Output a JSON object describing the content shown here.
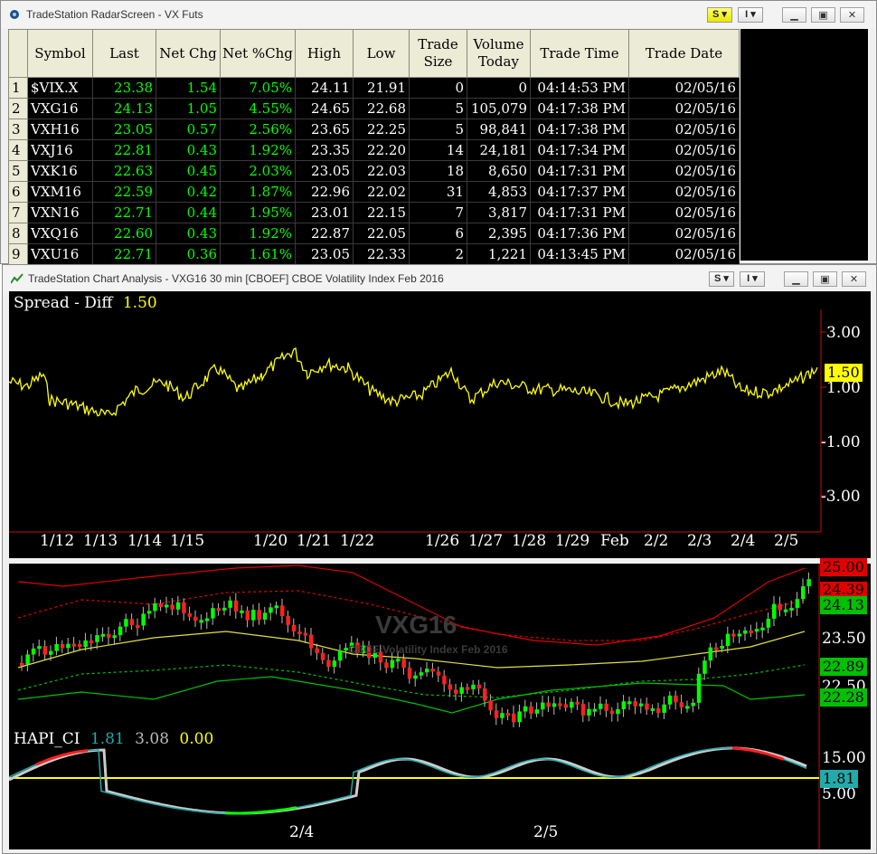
{
  "radar": {
    "title": "TradeStation RadarScreen - VX Futs",
    "btn_s": "S",
    "btn_i": "I",
    "columns": [
      "Symbol",
      "Last",
      "Net Chg",
      "Net %Chg",
      "High",
      "Low",
      "Trade Size",
      "Volume Today",
      "Trade Time",
      "Trade Date"
    ],
    "rows": [
      {
        "n": "1",
        "symbol": "$VIX.X",
        "last": "23.38",
        "net_chg": "1.54",
        "net_pct": "7.05%",
        "high": "24.11",
        "low": "21.91",
        "size": "0",
        "volume": "0",
        "time": "04:14:53 PM",
        "date": "02/05/16"
      },
      {
        "n": "2",
        "symbol": "VXG16",
        "last": "24.13",
        "net_chg": "1.05",
        "net_pct": "4.55%",
        "high": "24.65",
        "low": "22.68",
        "size": "5",
        "volume": "105,079",
        "time": "04:17:38 PM",
        "date": "02/05/16"
      },
      {
        "n": "3",
        "symbol": "VXH16",
        "last": "23.05",
        "net_chg": "0.57",
        "net_pct": "2.56%",
        "high": "23.65",
        "low": "22.25",
        "size": "5",
        "volume": "98,841",
        "time": "04:17:38 PM",
        "date": "02/05/16"
      },
      {
        "n": "4",
        "symbol": "VXJ16",
        "last": "22.81",
        "net_chg": "0.43",
        "net_pct": "1.92%",
        "high": "23.35",
        "low": "22.20",
        "size": "14",
        "volume": "24,181",
        "time": "04:17:34 PM",
        "date": "02/05/16"
      },
      {
        "n": "5",
        "symbol": "VXK16",
        "last": "22.63",
        "net_chg": "0.45",
        "net_pct": "2.03%",
        "high": "23.05",
        "low": "22.03",
        "size": "18",
        "volume": "8,650",
        "time": "04:17:31 PM",
        "date": "02/05/16"
      },
      {
        "n": "6",
        "symbol": "VXM16",
        "last": "22.59",
        "net_chg": "0.42",
        "net_pct": "1.87%",
        "high": "22.96",
        "low": "22.02",
        "size": "31",
        "volume": "4,853",
        "time": "04:17:37 PM",
        "date": "02/05/16"
      },
      {
        "n": "7",
        "symbol": "VXN16",
        "last": "22.71",
        "net_chg": "0.44",
        "net_pct": "1.95%",
        "high": "23.01",
        "low": "22.15",
        "size": "7",
        "volume": "3,817",
        "time": "04:17:31 PM",
        "date": "02/05/16"
      },
      {
        "n": "8",
        "symbol": "VXQ16",
        "last": "22.60",
        "net_chg": "0.43",
        "net_pct": "1.92%",
        "high": "22.87",
        "low": "22.05",
        "size": "6",
        "volume": "2,395",
        "time": "04:17:36 PM",
        "date": "02/05/16"
      },
      {
        "n": "9",
        "symbol": "VXU16",
        "last": "22.71",
        "net_chg": "0.36",
        "net_pct": "1.61%",
        "high": "23.05",
        "low": "22.33",
        "size": "2",
        "volume": "1,221",
        "time": "04:13:45 PM",
        "date": "02/05/16"
      }
    ]
  },
  "chart": {
    "title": "TradeStation Chart Analysis - VXG16 30 min [CBOEF] CBOE Volatility Index Feb 2016",
    "btn_s": "S",
    "btn_i": "I",
    "spread": {
      "label": "Spread - Diff",
      "value": "1.50",
      "yticks": [
        "3.00",
        "1.00",
        "-1.00",
        "-3.00"
      ],
      "last_tag": "1.50",
      "dates": [
        "1/12",
        "1/13",
        "1/14",
        "1/15",
        "1/20",
        "1/21",
        "1/22",
        "1/26",
        "1/27",
        "1/28",
        "1/29",
        "Feb",
        "2/2",
        "2/3",
        "2/4",
        "2/5"
      ]
    },
    "price": {
      "watermark": "VXG16",
      "watermark_sub": "CBOE Volatility Index Feb 2016",
      "ticks": [
        "25.00",
        "24.39",
        "24.13",
        "23.50",
        "22.89",
        "22.50",
        "22.28"
      ],
      "tag_colors": {
        "red": "#e00000",
        "green": "#00c000",
        "last": "#00c000"
      }
    },
    "hapi": {
      "label": "HAPI_CI",
      "v1": "1.81",
      "v2": "3.08",
      "v3": "0.00",
      "ticks": [
        "15.00",
        "1.81",
        "5.00"
      ],
      "dates": [
        "2/4",
        "2/5"
      ]
    }
  },
  "colors": {
    "up": "#00ff00",
    "down": "#ff2020",
    "spread": "#ffff00",
    "teal": "#22aaaa"
  }
}
